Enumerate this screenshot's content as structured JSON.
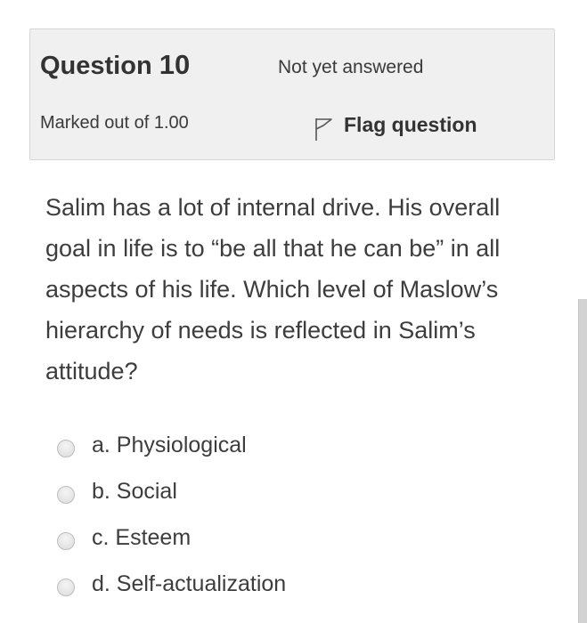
{
  "question_info": {
    "label": "Question",
    "number": "10",
    "state": "Not yet answered",
    "grade": "Marked out of 1.00",
    "flag_label": "Flag question",
    "flag_icon": "flag-outline-icon"
  },
  "question": {
    "text": "Salim has a lot of internal drive. His overall goal in life is to “be all that he can be” in all aspects of his life. Which level of Maslow’s hierarchy of needs is reflected in Salim’s attitude?"
  },
  "answers": [
    {
      "label": "a. Physiological",
      "selected": false
    },
    {
      "label": "b. Social",
      "selected": false
    },
    {
      "label": "c. Esteem",
      "selected": false
    },
    {
      "label": "d. Self-actualization",
      "selected": false
    }
  ],
  "colors": {
    "info_background": "#f0f0f0",
    "info_border": "#d6d6d6",
    "text": "#333333",
    "scrollbar": "#d2d2d2"
  }
}
